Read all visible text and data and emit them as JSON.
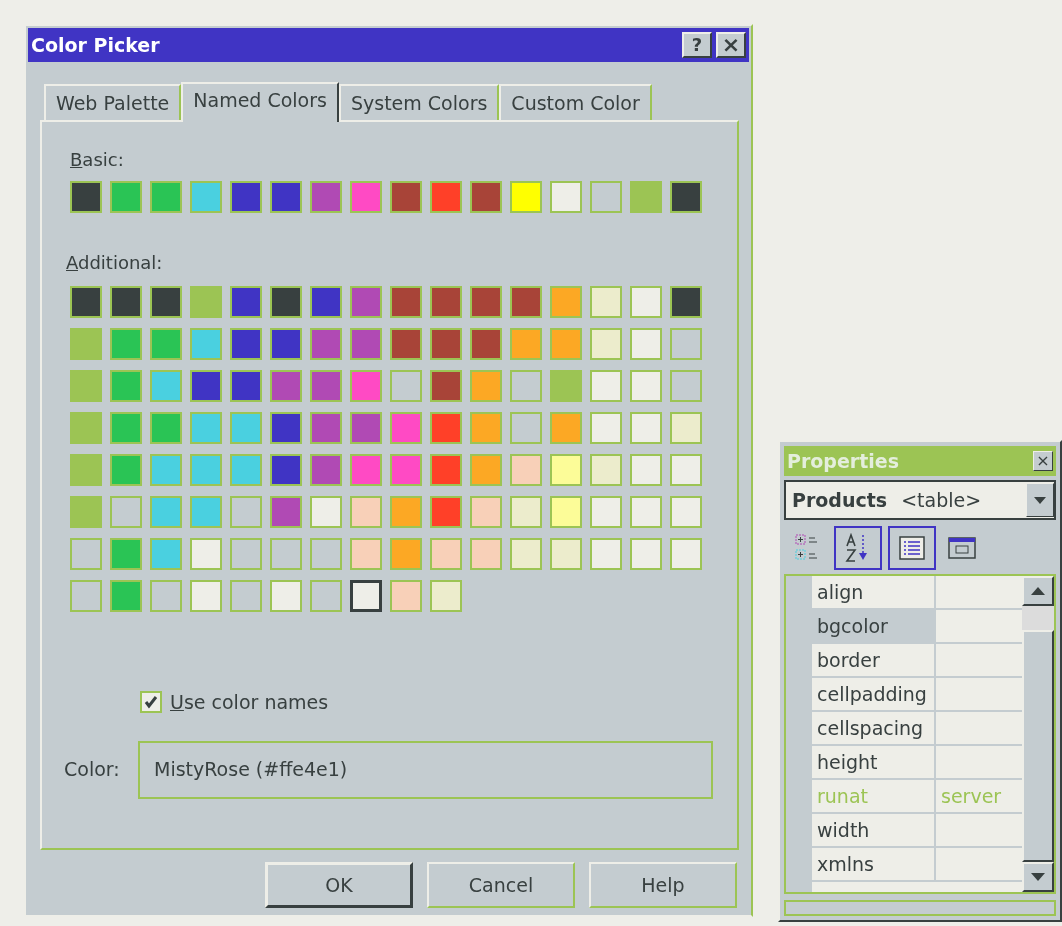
{
  "dialog": {
    "title": "Color Picker",
    "help_button": "?",
    "close_button": "×",
    "tabs": [
      {
        "label": "Web Palette",
        "selected": false
      },
      {
        "label": "Named Colors",
        "selected": true
      },
      {
        "label": "System Colors",
        "selected": false
      },
      {
        "label": "Custom Color",
        "selected": false
      }
    ],
    "basic": {
      "label": "Basic:",
      "swatches": [
        {
          "color": "#384040",
          "selected": false
        },
        {
          "color": "#2ac455",
          "selected": false
        },
        {
          "color": "#2ac455",
          "selected": false
        },
        {
          "color": "#4ad0e0",
          "selected": false
        },
        {
          "color": "#4034c4",
          "selected": false
        },
        {
          "color": "#4034c4",
          "selected": false
        },
        {
          "color": "#b04ab4",
          "selected": false
        },
        {
          "color": "#ff4ac4",
          "selected": false
        },
        {
          "color": "#a84438",
          "selected": false
        },
        {
          "color": "#ff4028",
          "selected": false
        },
        {
          "color": "#a84438",
          "selected": false
        },
        {
          "color": "#ffff00",
          "selected": false
        },
        {
          "color": "#eeeee8",
          "selected": false
        },
        {
          "color": "#c4ccd0",
          "selected": false
        },
        {
          "color": "#9cc454",
          "selected": false
        },
        {
          "color": "#384040",
          "selected": false
        }
      ]
    },
    "additional": {
      "label": "Additional:",
      "rows": [
        [
          {
            "color": "#384040",
            "selected": false
          },
          {
            "color": "#384040",
            "selected": false
          },
          {
            "color": "#384040",
            "selected": false
          },
          {
            "color": "#9cc454",
            "selected": false
          },
          {
            "color": "#4034c4",
            "selected": false
          },
          {
            "color": "#384040",
            "selected": false
          },
          {
            "color": "#4034c4",
            "selected": false
          },
          {
            "color": "#b04ab4",
            "selected": false
          },
          {
            "color": "#a84438",
            "selected": false
          },
          {
            "color": "#a84438",
            "selected": false
          },
          {
            "color": "#a84438",
            "selected": false
          },
          {
            "color": "#a84438",
            "selected": false
          },
          {
            "color": "#fca824",
            "selected": false
          },
          {
            "color": "#ececcc",
            "selected": false
          },
          {
            "color": "#eeeee8",
            "selected": false
          },
          {
            "color": "#384040",
            "selected": false
          }
        ],
        [
          {
            "color": "#9cc454",
            "selected": false
          },
          {
            "color": "#2ac455",
            "selected": false
          },
          {
            "color": "#2ac455",
            "selected": false
          },
          {
            "color": "#4ad0e0",
            "selected": false
          },
          {
            "color": "#4034c4",
            "selected": false
          },
          {
            "color": "#4034c4",
            "selected": false
          },
          {
            "color": "#b04ab4",
            "selected": false
          },
          {
            "color": "#b04ab4",
            "selected": false
          },
          {
            "color": "#a84438",
            "selected": false
          },
          {
            "color": "#a84438",
            "selected": false
          },
          {
            "color": "#a84438",
            "selected": false
          },
          {
            "color": "#fca824",
            "selected": false
          },
          {
            "color": "#fca824",
            "selected": false
          },
          {
            "color": "#ececcc",
            "selected": false
          },
          {
            "color": "#eeeee8",
            "selected": false
          },
          {
            "color": "#c4ccd0",
            "selected": false
          }
        ],
        [
          {
            "color": "#9cc454",
            "selected": false
          },
          {
            "color": "#2ac455",
            "selected": false
          },
          {
            "color": "#4ad0e0",
            "selected": false
          },
          {
            "color": "#4034c4",
            "selected": false
          },
          {
            "color": "#4034c4",
            "selected": false
          },
          {
            "color": "#b04ab4",
            "selected": false
          },
          {
            "color": "#b04ab4",
            "selected": false
          },
          {
            "color": "#ff4ac4",
            "selected": false
          },
          {
            "color": "#c4ccd0",
            "selected": false
          },
          {
            "color": "#a84438",
            "selected": false
          },
          {
            "color": "#fca824",
            "selected": false
          },
          {
            "color": "#c4ccd0",
            "selected": false
          },
          {
            "color": "#9cc454",
            "selected": false
          },
          {
            "color": "#eeeee8",
            "selected": false
          },
          {
            "color": "#eeeee8",
            "selected": false
          },
          {
            "color": "#c4ccd0",
            "selected": false
          }
        ],
        [
          {
            "color": "#9cc454",
            "selected": false
          },
          {
            "color": "#2ac455",
            "selected": false
          },
          {
            "color": "#2ac455",
            "selected": false
          },
          {
            "color": "#4ad0e0",
            "selected": false
          },
          {
            "color": "#4ad0e0",
            "selected": false
          },
          {
            "color": "#4034c4",
            "selected": false
          },
          {
            "color": "#b04ab4",
            "selected": false
          },
          {
            "color": "#b04ab4",
            "selected": false
          },
          {
            "color": "#ff4ac4",
            "selected": false
          },
          {
            "color": "#ff4028",
            "selected": false
          },
          {
            "color": "#fca824",
            "selected": false
          },
          {
            "color": "#c4ccd0",
            "selected": false
          },
          {
            "color": "#fca824",
            "selected": false
          },
          {
            "color": "#eeeee8",
            "selected": false
          },
          {
            "color": "#eeeee8",
            "selected": false
          },
          {
            "color": "#ececcc",
            "selected": false
          }
        ],
        [
          {
            "color": "#9cc454",
            "selected": false
          },
          {
            "color": "#2ac455",
            "selected": false
          },
          {
            "color": "#4ad0e0",
            "selected": false
          },
          {
            "color": "#4ad0e0",
            "selected": false
          },
          {
            "color": "#4ad0e0",
            "selected": false
          },
          {
            "color": "#4034c4",
            "selected": false
          },
          {
            "color": "#b04ab4",
            "selected": false
          },
          {
            "color": "#ff4ac4",
            "selected": false
          },
          {
            "color": "#ff4ac4",
            "selected": false
          },
          {
            "color": "#ff4028",
            "selected": false
          },
          {
            "color": "#fca824",
            "selected": false
          },
          {
            "color": "#f8d0b8",
            "selected": false
          },
          {
            "color": "#fcfc98",
            "selected": false
          },
          {
            "color": "#ececcc",
            "selected": false
          },
          {
            "color": "#eeeee8",
            "selected": false
          },
          {
            "color": "#eeeee8",
            "selected": false
          }
        ],
        [
          {
            "color": "#9cc454",
            "selected": false
          },
          {
            "color": "#c4ccd0",
            "selected": false
          },
          {
            "color": "#4ad0e0",
            "selected": false
          },
          {
            "color": "#4ad0e0",
            "selected": false
          },
          {
            "color": "#c4ccd0",
            "selected": false
          },
          {
            "color": "#b04ab4",
            "selected": false
          },
          {
            "color": "#eeeee8",
            "selected": false
          },
          {
            "color": "#f8d0b8",
            "selected": false
          },
          {
            "color": "#fca824",
            "selected": false
          },
          {
            "color": "#ff4028",
            "selected": false
          },
          {
            "color": "#f8d0b8",
            "selected": false
          },
          {
            "color": "#ececcc",
            "selected": false
          },
          {
            "color": "#fcfc98",
            "selected": false
          },
          {
            "color": "#eeeee8",
            "selected": false
          },
          {
            "color": "#eeeee8",
            "selected": false
          },
          {
            "color": "#eeeee8",
            "selected": false
          }
        ],
        [
          {
            "color": "#c4ccd0",
            "selected": false
          },
          {
            "color": "#2ac455",
            "selected": false
          },
          {
            "color": "#4ad0e0",
            "selected": false
          },
          {
            "color": "#eeeee8",
            "selected": false
          },
          {
            "color": "#c4ccd0",
            "selected": false
          },
          {
            "color": "#c4ccd0",
            "selected": false
          },
          {
            "color": "#c4ccd0",
            "selected": false
          },
          {
            "color": "#f8d0b8",
            "selected": false
          },
          {
            "color": "#fca824",
            "selected": false
          },
          {
            "color": "#f8d0b8",
            "selected": false
          },
          {
            "color": "#f8d0b8",
            "selected": false
          },
          {
            "color": "#ececcc",
            "selected": false
          },
          {
            "color": "#ececcc",
            "selected": false
          },
          {
            "color": "#eeeee8",
            "selected": false
          },
          {
            "color": "#eeeee8",
            "selected": false
          },
          {
            "color": "#eeeee8",
            "selected": false
          }
        ],
        [
          {
            "color": "#c4ccd0",
            "selected": false
          },
          {
            "color": "#2ac455",
            "selected": false
          },
          {
            "color": "#c4ccd0",
            "selected": false
          },
          {
            "color": "#eeeee8",
            "selected": false
          },
          {
            "color": "#c4ccd0",
            "selected": false
          },
          {
            "color": "#eeeee8",
            "selected": false
          },
          {
            "color": "#c4ccd0",
            "selected": false
          },
          {
            "color": "#eeeee8",
            "selected": true
          },
          {
            "color": "#f8d0b8",
            "selected": false
          },
          {
            "color": "#ececcc",
            "selected": false
          }
        ]
      ]
    },
    "use_color_names": {
      "label": "Use color names",
      "checked": true
    },
    "color_field": {
      "label": "Color:",
      "value": "MistyRose (#ffe4e1)"
    },
    "buttons": [
      {
        "label": "OK",
        "default": true
      },
      {
        "label": "Cancel",
        "default": false
      },
      {
        "label": "Help",
        "default": false
      }
    ]
  },
  "properties": {
    "title": "Properties",
    "close_button": "×",
    "object_selector": {
      "name": "Products",
      "type": "<table>"
    },
    "toolbar": [
      {
        "kind": "categorized",
        "pressed": false
      },
      {
        "kind": "alphabetic",
        "pressed": true
      },
      {
        "kind": "properties",
        "pressed": true
      },
      {
        "kind": "events",
        "pressed": false
      }
    ],
    "rows": [
      {
        "name": "align",
        "value": "",
        "selected": false,
        "modified": false
      },
      {
        "name": "bgcolor",
        "value": "",
        "selected": true,
        "modified": false
      },
      {
        "name": "border",
        "value": "",
        "selected": false,
        "modified": false
      },
      {
        "name": "cellpadding",
        "value": "",
        "selected": false,
        "modified": false
      },
      {
        "name": "cellspacing",
        "value": "",
        "selected": false,
        "modified": false
      },
      {
        "name": "height",
        "value": "",
        "selected": false,
        "modified": false
      },
      {
        "name": "runat",
        "value": "server",
        "selected": false,
        "modified": true
      },
      {
        "name": "width",
        "value": "",
        "selected": false,
        "modified": false
      },
      {
        "name": "xmlns",
        "value": "",
        "selected": false,
        "modified": false
      }
    ]
  }
}
